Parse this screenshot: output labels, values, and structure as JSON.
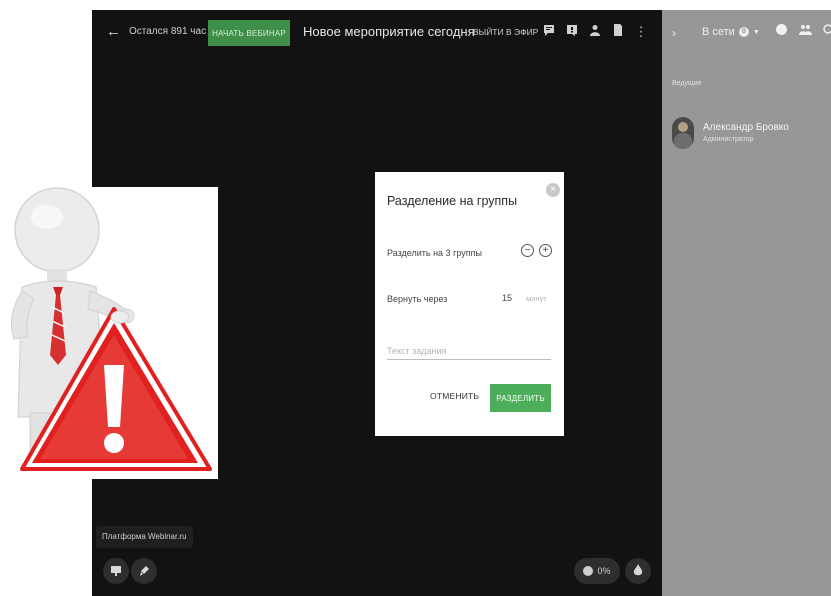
{
  "topbar": {
    "time_left": "Остался 891 час",
    "start_button": "НАЧАТЬ ВЕБИНАР",
    "event_title": "Новое мероприятие сегодня",
    "go_live": "ВЫЙТИ В ЭФИР",
    "icons": [
      "chat-icon",
      "questions-icon",
      "user-icon",
      "file-icon",
      "more-vertical-icon"
    ]
  },
  "platform_label": "Платформа Webinar.ru",
  "progress": {
    "label": "0%",
    "value": 0
  },
  "sidebar": {
    "online_label": "В сети",
    "online_count_badge": "0",
    "hosts_label": "Ведущие",
    "host": {
      "name": "Александр Бровко",
      "role": "Администратор"
    }
  },
  "dialog": {
    "title": "Разделение на группы",
    "split_label": "Разделить на 3 группы",
    "return_label": "Вернуть через",
    "return_value": "15",
    "return_unit": "минут",
    "task_placeholder": "Текст задания",
    "cancel_label": "ОТМЕНИТЬ",
    "split_button": "РАЗДЕЛИТЬ"
  },
  "colors": {
    "stage_bg": "#121212",
    "sidebar_bg": "#979797",
    "start_button_bg": "#3f8f4a",
    "split_button_bg": "#4cae5a",
    "warning_red": "#e0211f"
  }
}
